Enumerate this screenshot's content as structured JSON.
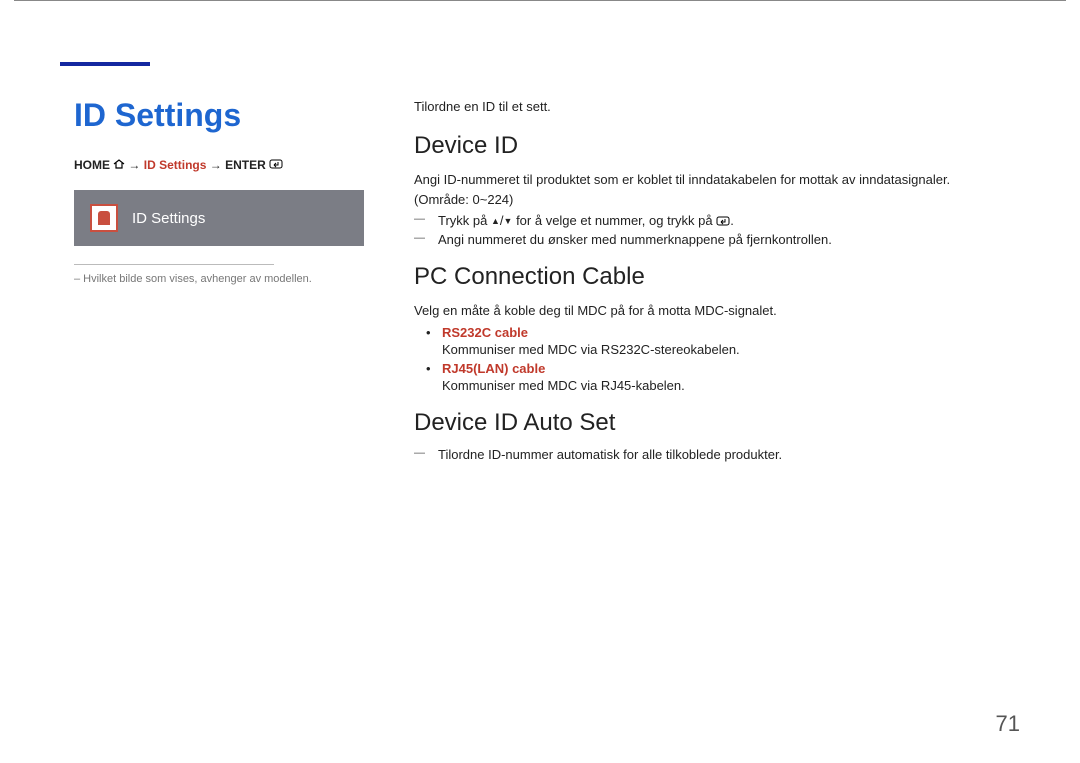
{
  "page_number": "71",
  "left": {
    "title": "ID Settings",
    "breadcrumb": {
      "p1": "HOME",
      "arrow": "→",
      "highlight": "ID Settings",
      "p3": "ENTER"
    },
    "card_label": "ID Settings",
    "note": "– Hvilket bilde som vises, avhenger av modellen."
  },
  "right": {
    "intro": "Tilordne en ID til et sett.",
    "s1": {
      "heading": "Device ID",
      "body": "Angi ID-nummeret til produktet som er koblet til inndatakabelen for mottak av inndatasignaler. (Område: 0~224)",
      "li1_a": "Trykk på ",
      "li1_b": " for å velge et nummer, og trykk på ",
      "li1_c": ".",
      "li2": "Angi nummeret du ønsker med nummerknappene på fjernkontrollen."
    },
    "s2": {
      "heading": "PC Connection Cable",
      "body": "Velg en måte å koble deg til MDC på for å motta MDC-signalet.",
      "opt1_title": "RS232C cable",
      "opt1_desc": "Kommuniser med MDC via RS232C-stereokabelen.",
      "opt2_title": "RJ45(LAN) cable",
      "opt2_desc": "Kommuniser med MDC via RJ45-kabelen."
    },
    "s3": {
      "heading": "Device ID Auto Set",
      "li1": "Tilordne ID-nummer automatisk for alle tilkoblede produkter."
    }
  }
}
